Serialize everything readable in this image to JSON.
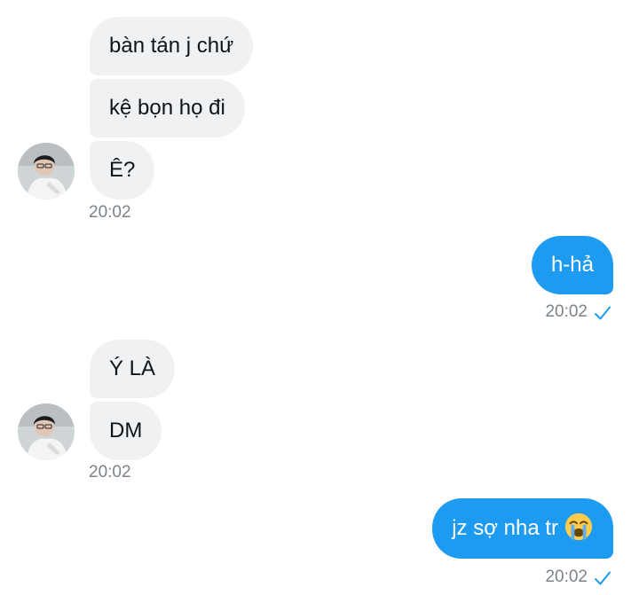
{
  "messages": {
    "g1_m1": "bàn tán j chứ",
    "g1_m2": "kệ bọn họ đi",
    "g1_m3": "Ê?",
    "g1_time": "20:02",
    "g2_m1": "h-hả",
    "g2_time": "20:02",
    "g3_m1": "Ý LÀ",
    "g3_m2": "DM",
    "g3_time": "20:02",
    "g4_m1": "jz sợ nha tr",
    "g4_time": "20:02"
  },
  "icons": {
    "avatar": "contact-avatar",
    "read_receipt": "checkmark-icon",
    "emoji": "loudly-crying-face-emoji"
  },
  "colors": {
    "incoming_bubble": "#eff1f3",
    "outgoing_bubble": "#1d9bf0",
    "timestamp": "#7b8288",
    "checkmark": "#1d9bf0"
  }
}
